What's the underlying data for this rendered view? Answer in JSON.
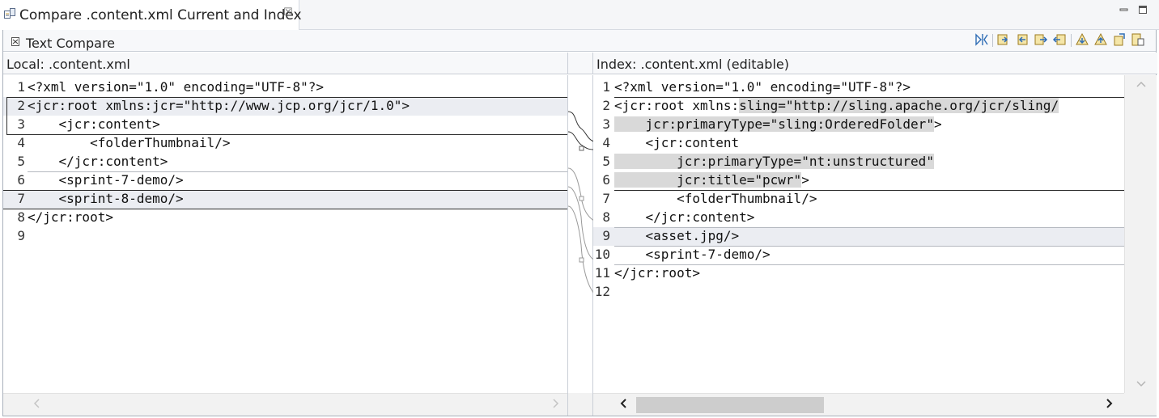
{
  "editor_tab": {
    "title": "Compare .content.xml Current and Index",
    "close_glyph": "☒"
  },
  "compare": {
    "title": "Text Compare"
  },
  "left_pane": {
    "title": "Local: .content.xml",
    "lines": [
      {
        "num": "1",
        "text": "<?xml version=\"1.0\" encoding=\"UTF-8\"?>"
      },
      {
        "num": "2",
        "text": "<jcr:root xmlns:jcr=\"http://www.jcp.org/jcr/1.0\">"
      },
      {
        "num": "3",
        "text": "    <jcr:content>"
      },
      {
        "num": "4",
        "text": "        <folderThumbnail/>"
      },
      {
        "num": "5",
        "text": "    </jcr:content>"
      },
      {
        "num": "6",
        "text": "    <sprint-7-demo/>"
      },
      {
        "num": "7",
        "text": "    <sprint-8-demo/>"
      },
      {
        "num": "8",
        "text": "</jcr:root>"
      },
      {
        "num": "9",
        "text": ""
      }
    ]
  },
  "right_pane": {
    "title": "Index: .content.xml (editable)",
    "lines": [
      {
        "num": "1",
        "text": "<?xml version=\"1.0\" encoding=\"UTF-8\"?>"
      },
      {
        "num": "2",
        "pre": "<jcr:root xmlns:",
        "hl": "sling=\"http://sling.apache.org/jcr/sling/"
      },
      {
        "num": "3",
        "pre": "    ",
        "hl": "jcr:primaryType=\"sling:OrderedFolder\"",
        "post": ">"
      },
      {
        "num": "4",
        "text": "    <jcr:content"
      },
      {
        "num": "5",
        "pre": "        ",
        "hl": "jcr:primaryType=\"nt:unstructured\""
      },
      {
        "num": "6",
        "pre": "        ",
        "hl": "jcr:title=\"pcwr\"",
        "post": ">"
      },
      {
        "num": "7",
        "text": "        <folderThumbnail/>"
      },
      {
        "num": "8",
        "text": "    </jcr:content>"
      },
      {
        "num": "9",
        "text": "    <asset.jpg/>"
      },
      {
        "num": "10",
        "text": "    <sprint-7-demo/>"
      },
      {
        "num": "11",
        "text": "</jcr:root>"
      },
      {
        "num": "12",
        "text": ""
      }
    ]
  },
  "icons": {
    "tab": "compare-editor-icon",
    "compare_view": "text-compare-icon",
    "toolbar": [
      "ignore-whitespace-icon",
      "copy-all-left-to-right-icon",
      "copy-current-left-to-right-icon",
      "next-difference-icon",
      "previous-difference-icon",
      "next-change-icon",
      "previous-change-icon",
      "show-ancestor-icon",
      "swap-sides-icon"
    ]
  },
  "colors": {
    "changed_line_bg": "#ebedf2",
    "changed_text_bg": "#d9d9d9",
    "diff_border": "#2d2d2d"
  }
}
